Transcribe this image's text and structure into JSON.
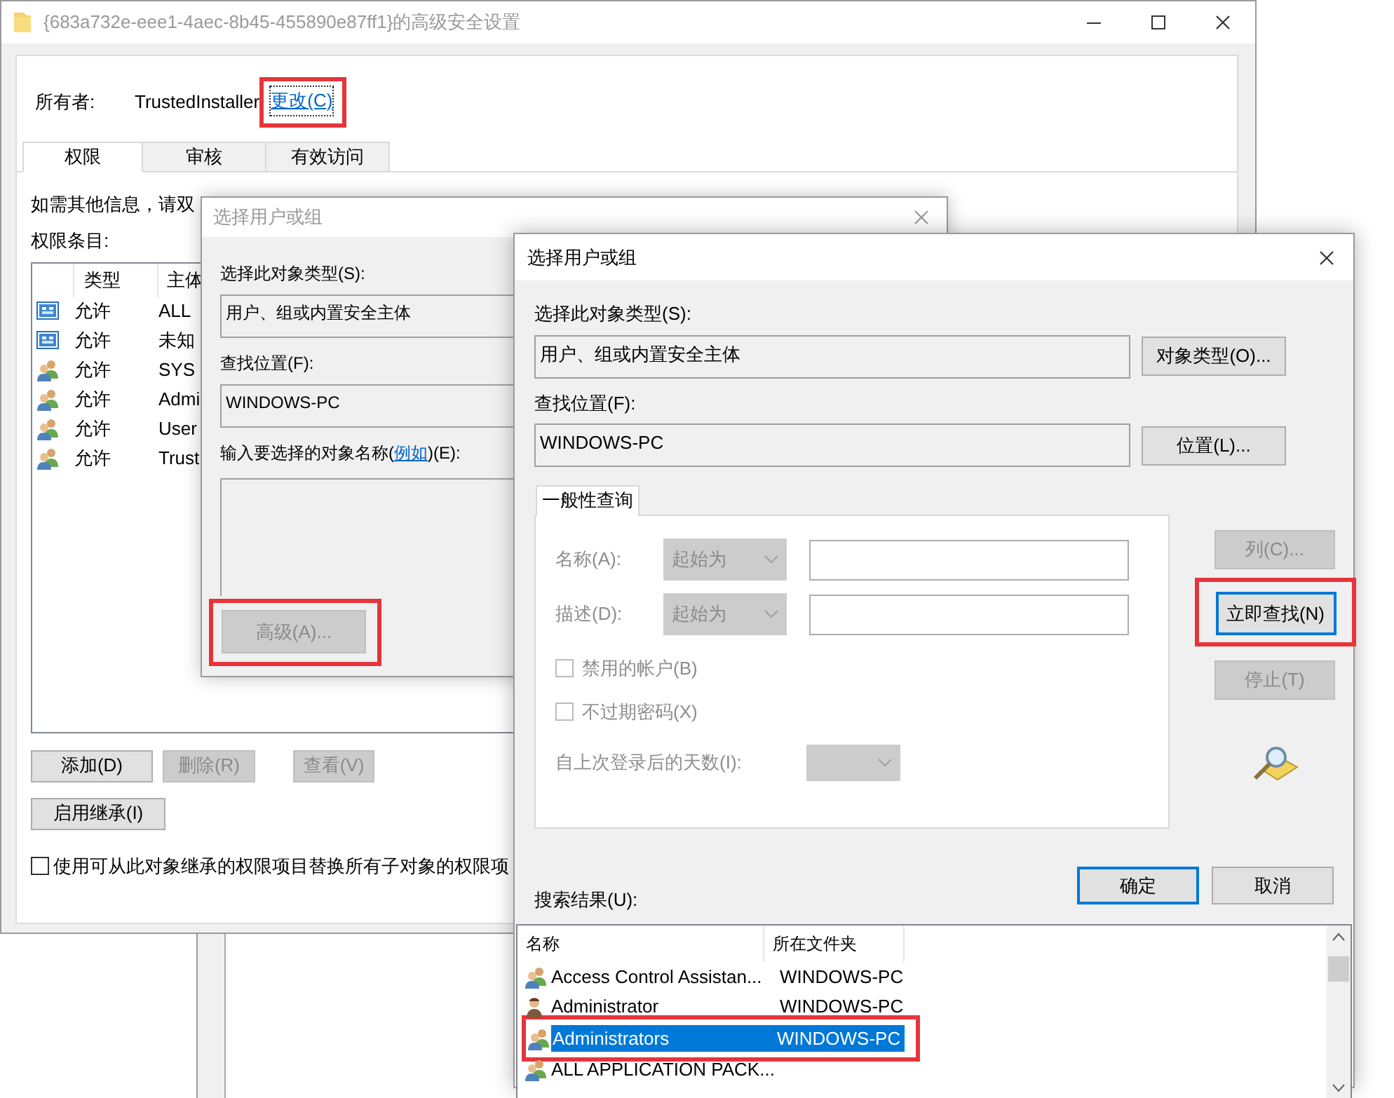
{
  "main_window": {
    "title": "{683a732e-eee1-4aec-8b45-455890e87ff1}的高级安全设置",
    "active": false,
    "owner_label": "所有者:",
    "owner": "TrustedInstaller",
    "change_link": {
      "label": "更改(C)",
      "highlighted": true
    },
    "tabs": [
      {
        "label": "权限",
        "selected": true
      },
      {
        "label": "审核",
        "selected": false
      },
      {
        "label": "有效访问",
        "selected": false
      }
    ],
    "info_text": "如需其他信息，请双",
    "entries_label": "权限条目:",
    "columns": [
      "类型",
      "主体"
    ],
    "entries": [
      {
        "kind": "package",
        "type": "允许",
        "principal": "ALL"
      },
      {
        "kind": "package",
        "type": "允许",
        "principal": "未知"
      },
      {
        "kind": "group",
        "type": "允许",
        "principal": "SYS"
      },
      {
        "kind": "group",
        "type": "允许",
        "principal": "Admi"
      },
      {
        "kind": "group",
        "type": "允许",
        "principal": "User"
      },
      {
        "kind": "group",
        "type": "允许",
        "principal": "Trust"
      }
    ],
    "buttons": [
      {
        "label": "添加(D)",
        "disabled": false
      },
      {
        "label": "删除(R)",
        "disabled": true
      },
      {
        "label": "查看(V)",
        "disabled": true
      }
    ],
    "inherit_button": "启用继承(I)",
    "replace_checkbox": {
      "label": "使用可从此对象继承的权限项目替换所有子对象的权限项",
      "checked": false
    }
  },
  "back_dialog": {
    "title": "选择用户或组",
    "active": false,
    "object_type_label": "选择此对象类型(S):",
    "object_type": "用户、组或内置安全主体",
    "location_label": "查找位置(F):",
    "location": "WINDOWS-PC",
    "names_label": {
      "prefix": "输入要选择的对象名称(",
      "link": "例如",
      "suffix": ")(E):"
    },
    "advanced_button": {
      "label": "高级(A)...",
      "disabled": true,
      "highlighted": true
    }
  },
  "front_dialog": {
    "title": "选择用户或组",
    "active": true,
    "object_type_label": "选择此对象类型(S):",
    "object_type": "用户、组或内置安全主体",
    "object_type_button": "对象类型(O)...",
    "location_label": "查找位置(F):",
    "location": "WINDOWS-PC",
    "location_button": "位置(L)...",
    "query_tab": "一般性查询",
    "query_rows": [
      {
        "label": "名称(A):",
        "operator": "起始为",
        "disabled": true
      },
      {
        "label": "描述(D):",
        "operator": "起始为",
        "disabled": true
      }
    ],
    "query_checks": [
      {
        "label": "禁用的帐户(B)",
        "checked": false,
        "disabled": true
      },
      {
        "label": "不过期密码(X)",
        "checked": false,
        "disabled": true
      }
    ],
    "days_label": "自上次登录后的天数(I):",
    "side_buttons": [
      {
        "label": "列(C)...",
        "disabled": true,
        "default": false,
        "highlighted": false
      },
      {
        "label": "立即查找(N)",
        "disabled": false,
        "default": true,
        "highlighted": true
      },
      {
        "label": "停止(T)",
        "disabled": true,
        "default": false,
        "highlighted": false
      }
    ],
    "dialog_buttons": [
      {
        "label": "确定",
        "default": true
      },
      {
        "label": "取消",
        "default": false
      }
    ],
    "results_label": "搜索结果(U):",
    "result_columns": [
      "名称",
      "所在文件夹"
    ],
    "results": [
      {
        "kind": "group",
        "name": "Access Control Assistan...",
        "folder": "WINDOWS-PC",
        "selected": false,
        "highlighted": false
      },
      {
        "kind": "user",
        "name": "Administrator",
        "folder": "WINDOWS-PC",
        "selected": false,
        "highlighted": false
      },
      {
        "kind": "group",
        "name": "Administrators",
        "folder": "WINDOWS-PC",
        "selected": true,
        "highlighted": true
      },
      {
        "kind": "group",
        "name": "ALL APPLICATION PACK...",
        "selected": false,
        "highlighted": false
      }
    ]
  }
}
